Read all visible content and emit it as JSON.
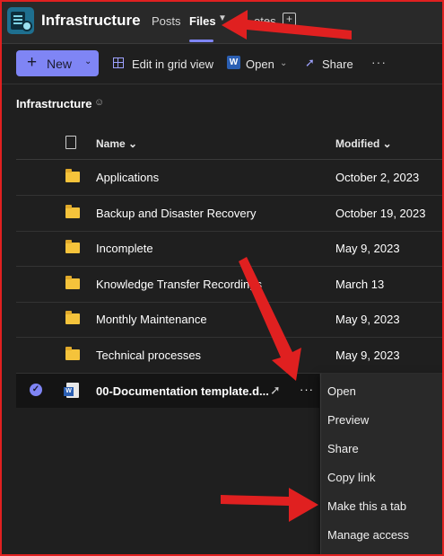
{
  "header": {
    "team_name": "Infrastructure",
    "tabs": [
      {
        "label": "Posts"
      },
      {
        "label": "Files"
      },
      {
        "label": "otes"
      }
    ]
  },
  "toolbar": {
    "new_label": "New",
    "edit_grid_label": "Edit in grid view",
    "open_label": "Open",
    "share_label": "Share"
  },
  "breadcrumb": {
    "title": "Infrastructure"
  },
  "table": {
    "columns": {
      "name": "Name",
      "modified": "Modified"
    },
    "folders": [
      {
        "name": "Applications",
        "modified": "October 2, 2023"
      },
      {
        "name": "Backup and Disaster Recovery",
        "modified": "October 19, 2023"
      },
      {
        "name": "Incomplete",
        "modified": "May 9, 2023"
      },
      {
        "name": "Knowledge Transfer Recordings",
        "modified": "March 13"
      },
      {
        "name": "Monthly Maintenance",
        "modified": "May 9, 2023"
      },
      {
        "name": "Technical processes",
        "modified": "May 9, 2023"
      }
    ],
    "selected_file": {
      "name": "00-Documentation template.d..."
    }
  },
  "context_menu": {
    "items": [
      {
        "label": "Open"
      },
      {
        "label": "Preview"
      },
      {
        "label": "Share"
      },
      {
        "label": "Copy link"
      },
      {
        "label": "Make this a tab"
      },
      {
        "label": "Manage access"
      }
    ]
  },
  "colors": {
    "accent": "#7f85f5",
    "background": "#1f1f1f",
    "annotation_arrow": "#e02020",
    "folder": "#f5c33b"
  }
}
